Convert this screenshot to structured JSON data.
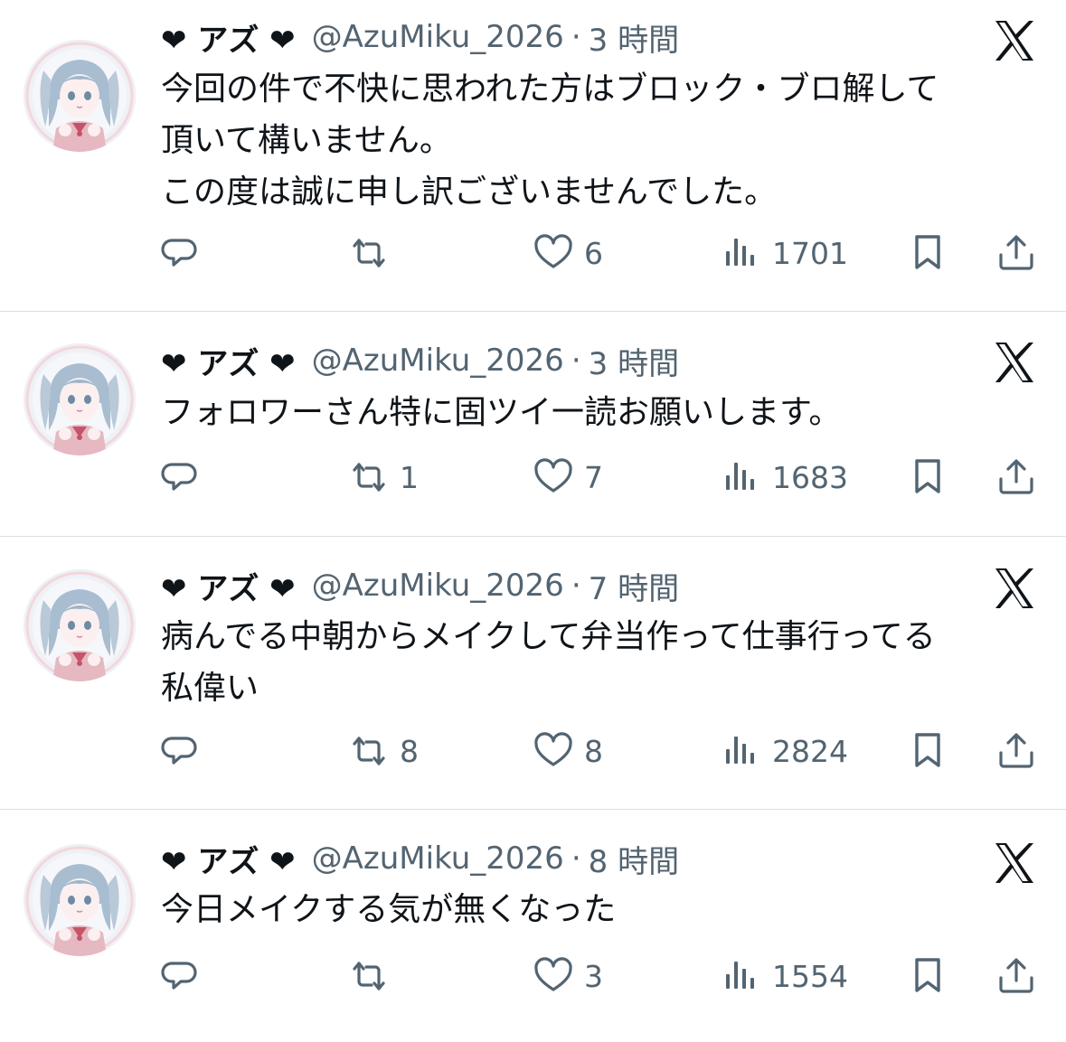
{
  "tweets": [
    {
      "display_name": "❤ アズ ❤",
      "handle": "@AzuMiku_2026",
      "separator": "·",
      "time": "3 時間",
      "text": "今回の件で不快に思われた方はブロック・ブロ解して\n頂いて構いません。\nこの度は誠に申し訳ございませんでした。",
      "replies": "",
      "retweets": "",
      "likes": "6",
      "views": "1701",
      "icons": [
        "reply-icon",
        "retweet-icon",
        "like-icon",
        "views-icon",
        "bookmark-icon",
        "share-icon",
        "x-logo-icon"
      ]
    },
    {
      "display_name": "❤ アズ ❤",
      "handle": "@AzuMiku_2026",
      "separator": "·",
      "time": "3 時間",
      "text": "フォロワーさん特に固ツイ一読お願いします。",
      "replies": "",
      "retweets": "1",
      "likes": "7",
      "views": "1683"
    },
    {
      "display_name": "❤ アズ ❤",
      "handle": "@AzuMiku_2026",
      "separator": "·",
      "time": "7 時間",
      "text": "病んでる中朝からメイクして弁当作って仕事行ってる\n私偉い",
      "replies": "",
      "retweets": "8",
      "likes": "8",
      "views": "2824"
    },
    {
      "display_name": "❤ アズ ❤",
      "handle": "@AzuMiku_2026",
      "separator": "·",
      "time": "8 時間",
      "text": "今日メイクする気が無くなった",
      "replies": "",
      "retweets": "",
      "likes": "3",
      "views": "1554"
    }
  ],
  "colors": {
    "text": "#0f1419",
    "muted": "#536471",
    "divider": "#dcdfe2"
  }
}
